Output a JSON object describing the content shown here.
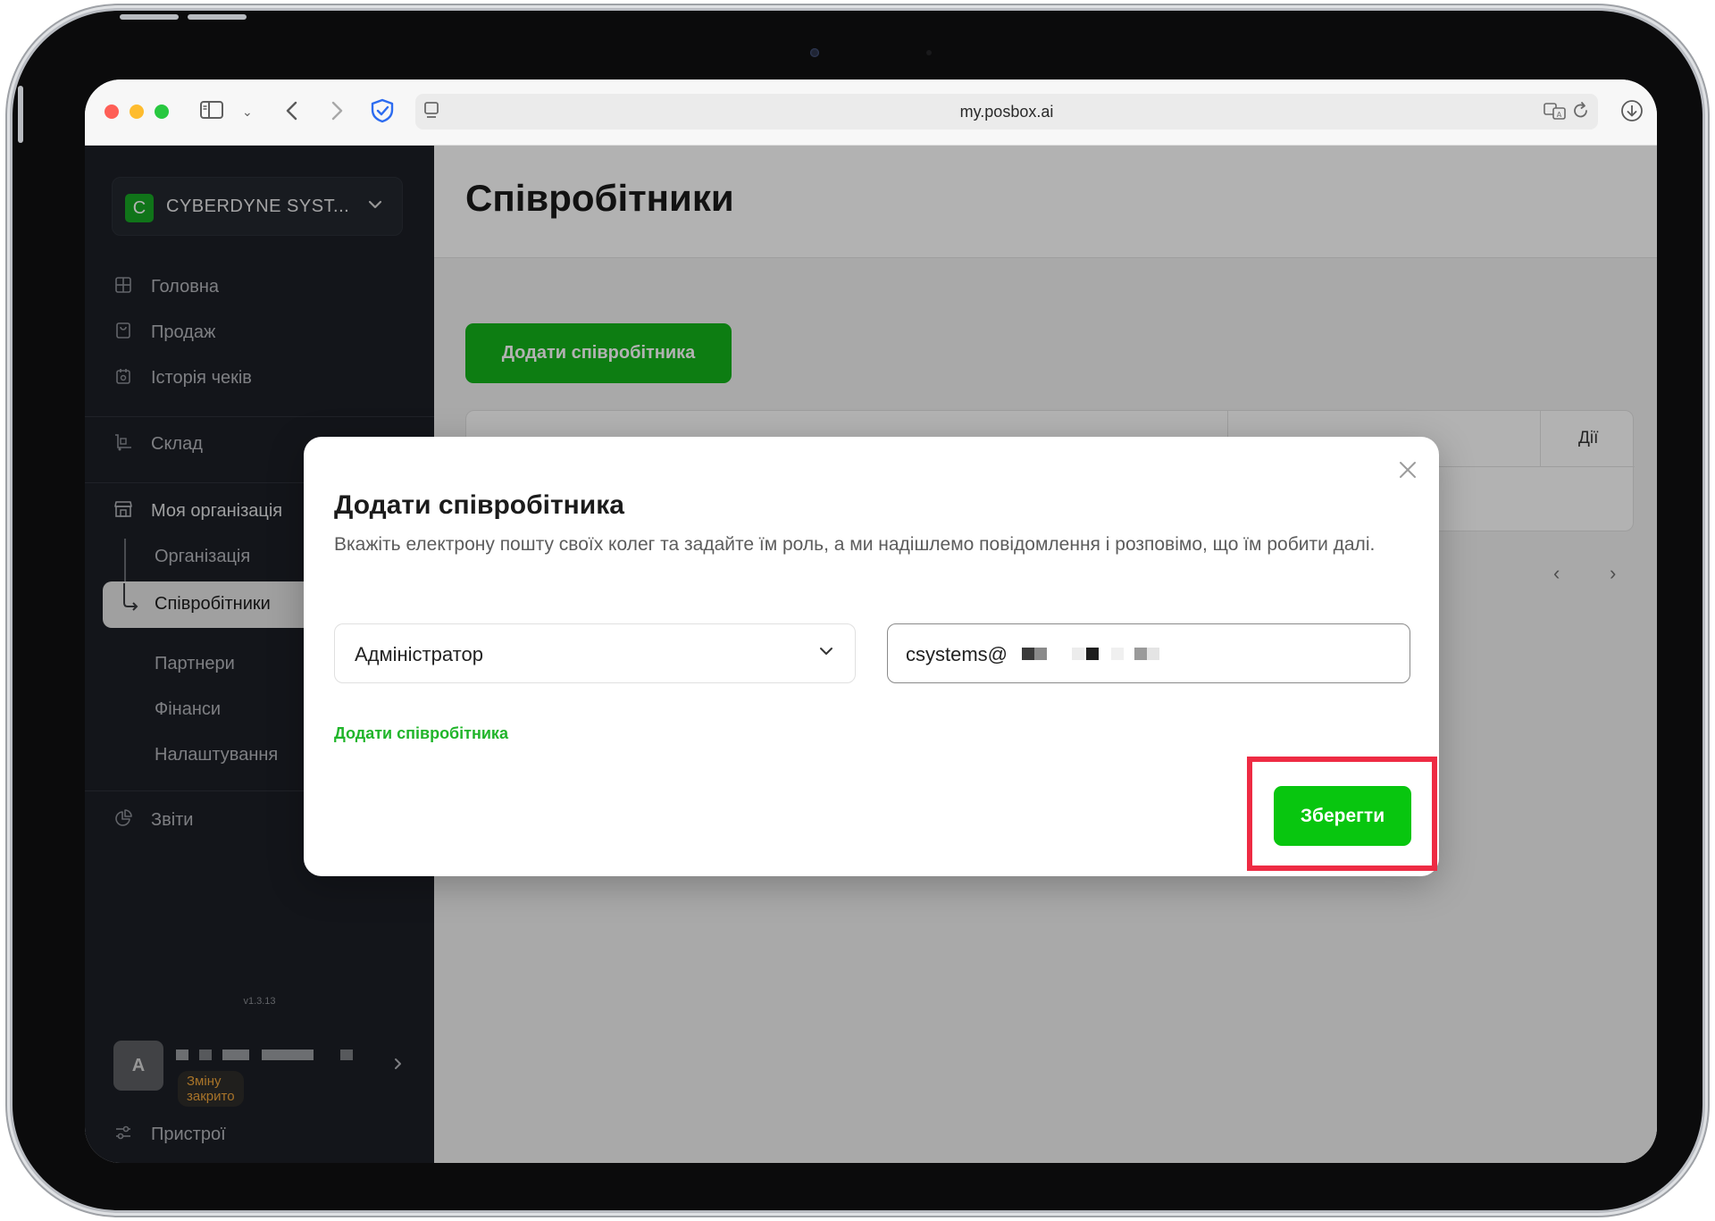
{
  "browser": {
    "url": "my.posbox.ai"
  },
  "sidebar": {
    "org_logo_letter": "C",
    "org_name": "CYBERDYNE SYST...",
    "items": [
      {
        "label": "Головна",
        "icon": "dashboard-icon"
      },
      {
        "label": "Продаж",
        "icon": "sale-icon"
      },
      {
        "label": "Історія чеків",
        "icon": "receipt-history-icon"
      },
      {
        "label": "Склад",
        "icon": "warehouse-icon"
      },
      {
        "label": "Моя організація",
        "icon": "store-icon"
      },
      {
        "label": "Організація"
      },
      {
        "label": "Співробітники"
      },
      {
        "label": "Партнери"
      },
      {
        "label": "Фінанси"
      },
      {
        "label": "Налаштування"
      },
      {
        "label": "Звіти",
        "icon": "reports-pie-icon"
      },
      {
        "label": "Пристрої",
        "icon": "devices-sliders-icon"
      }
    ],
    "version": "v1.3.13",
    "user": {
      "avatar_letter": "A",
      "shift_status": "Зміну закрито"
    }
  },
  "main": {
    "page_title": "Співробітники",
    "add_button": "Додати співробітника",
    "table": {
      "actions_header": "Дії"
    },
    "pagination": [
      "‹",
      "›",
      "›|"
    ]
  },
  "modal": {
    "title": "Додати співробітника",
    "description": "Вкажіть електрону пошту своїх колег та задайте їм роль, а ми надішлемо повідомлення і розповімо, що їм робити далі.",
    "role_value": "Адміністратор",
    "email_value": "csystems@",
    "add_link": "Додати співробітника",
    "save_button": "Зберегти"
  },
  "colors": {
    "accent_green": "#13b41a",
    "save_green": "#08c60f",
    "highlight_red": "#ee2b43",
    "sidebar_bg": "#1c1f26"
  }
}
